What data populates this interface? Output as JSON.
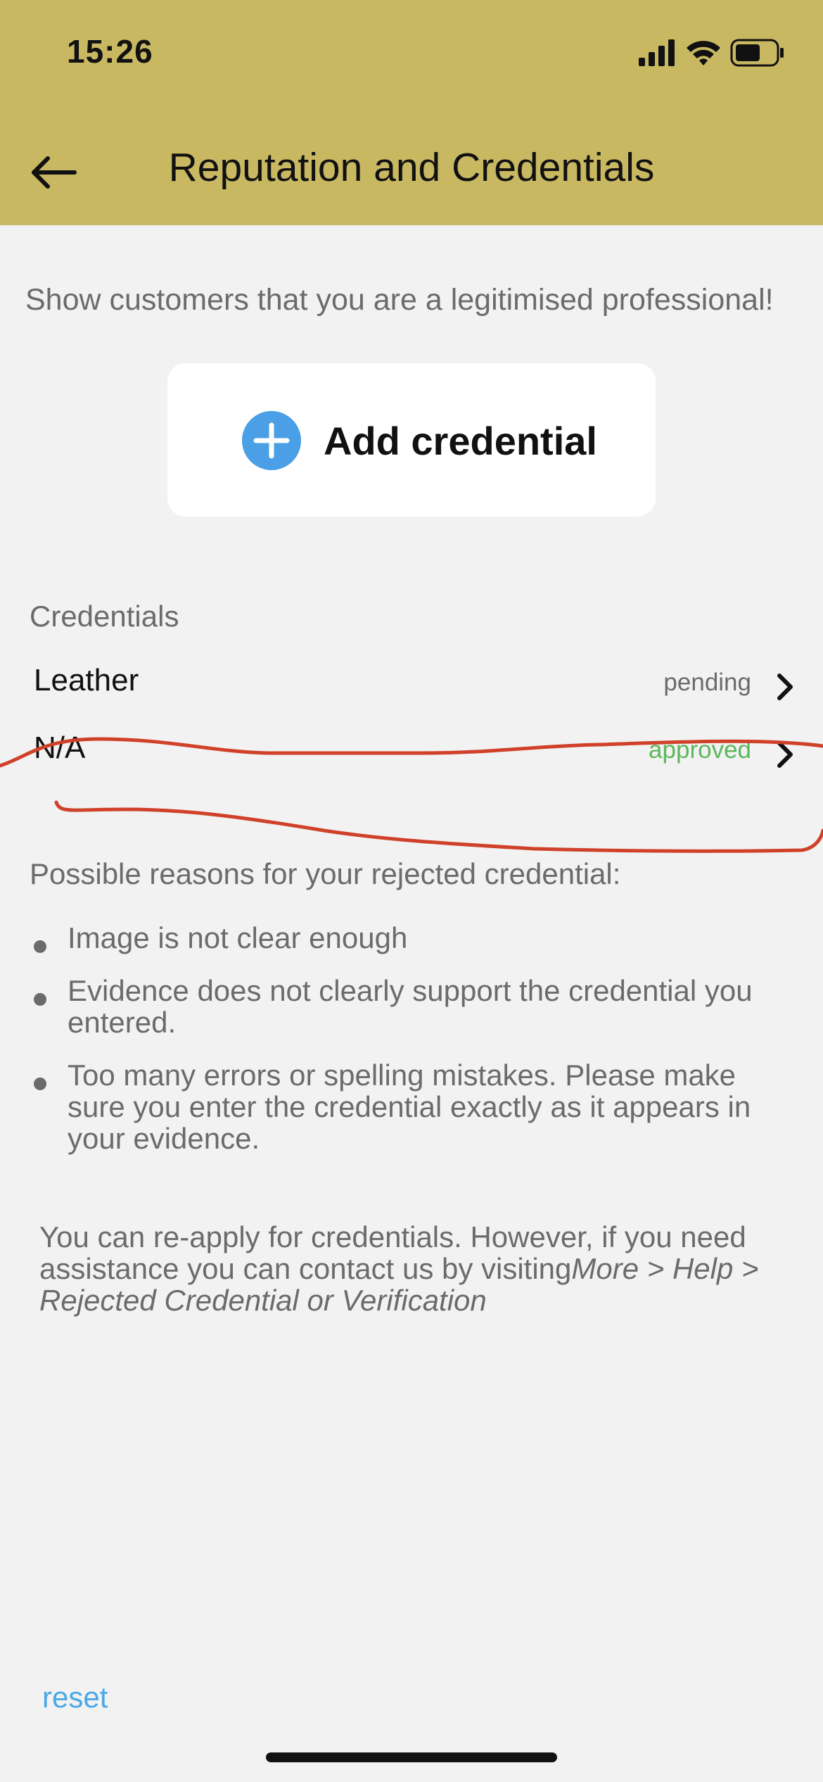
{
  "status_bar": {
    "time": "15:26"
  },
  "header": {
    "title": "Reputation and Credentials"
  },
  "intro_text": "Show customers that you are a legitimised professional!",
  "add_button": {
    "label": "Add credential"
  },
  "credentials": {
    "section_label": "Credentials",
    "items": [
      {
        "name": "Leather",
        "status": "pending"
      },
      {
        "name": "N/A",
        "status": "approved"
      }
    ]
  },
  "reasons": {
    "title": "Possible reasons for your rejected credential:",
    "items": [
      "Image is not clear enough",
      "Evidence does not clearly support the credential you entered.",
      "Too many errors or spelling mistakes. Please make sure you enter the credential exactly as it appears in your evidence."
    ]
  },
  "footer_note": {
    "text": "You can re-apply for credentials. However, if you need assistance you can contact us by visiting",
    "path": "More > Help > Rejected Credential or Verification"
  },
  "reset_label": "reset",
  "colors": {
    "header_bg": "#c9b862",
    "accent_blue": "#4a9fe6",
    "pending": "#6b6b6b",
    "approved": "#5cb85c",
    "annotation_red": "#d0412a"
  },
  "icons": [
    "back-arrow-icon",
    "plus-circle-icon",
    "chevron-right-icon",
    "signal-icon",
    "wifi-icon",
    "battery-icon"
  ]
}
